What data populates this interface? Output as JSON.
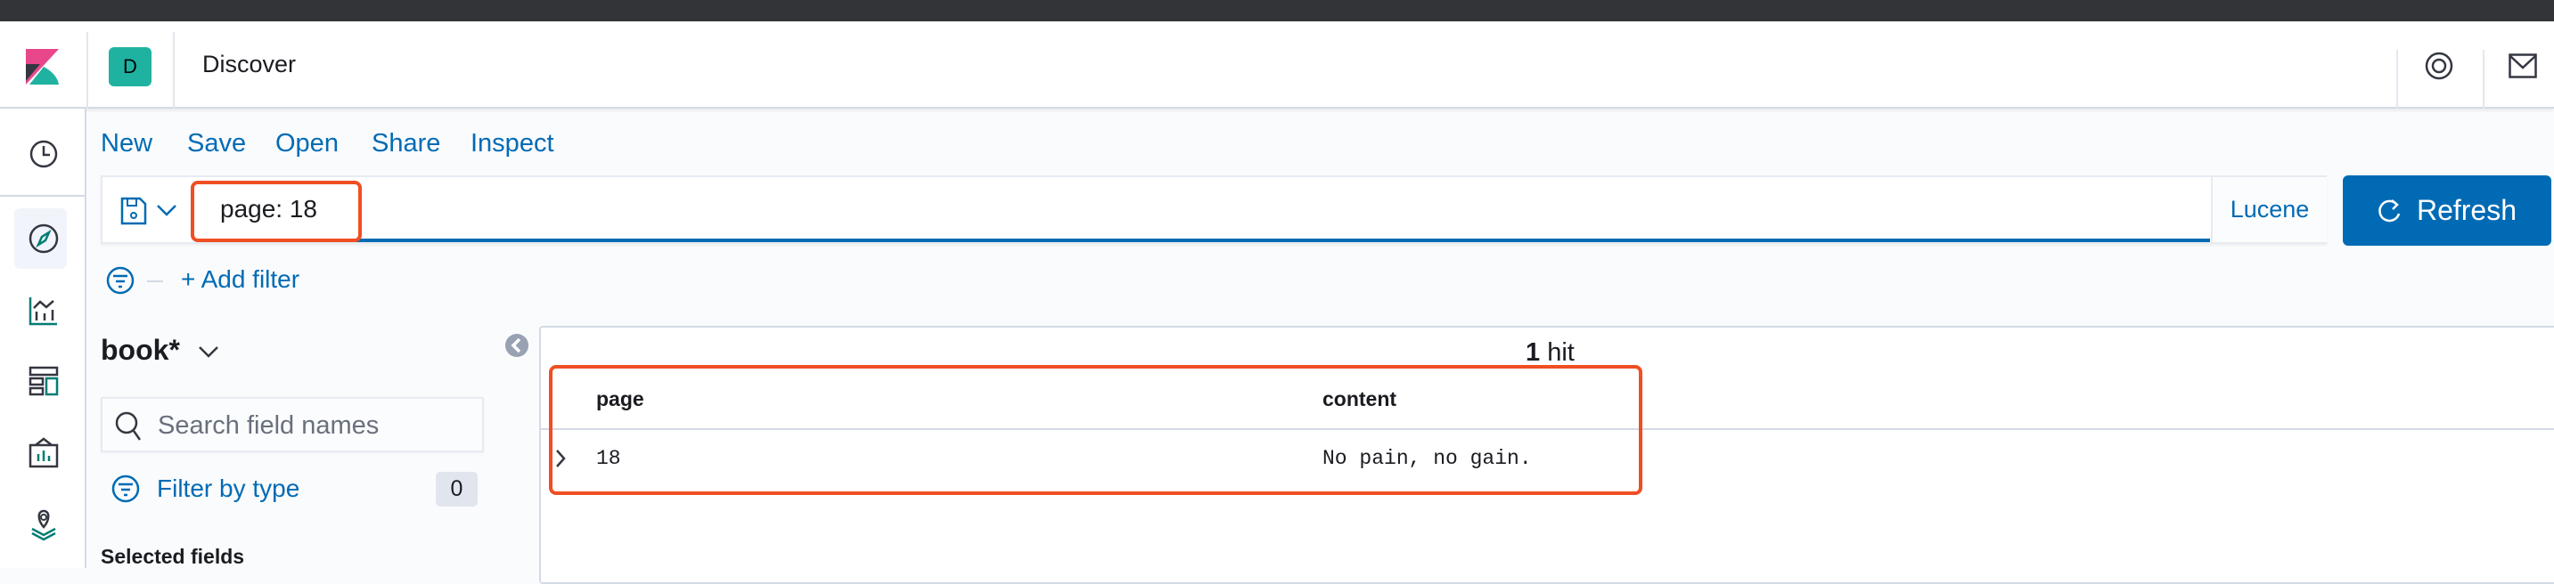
{
  "header": {
    "app_badge": "D",
    "title": "Discover"
  },
  "top_menu": [
    "New",
    "Save",
    "Open",
    "Share",
    "Inspect"
  ],
  "query": {
    "value": "page: 18",
    "language": "Lucene",
    "refresh_label": "Refresh"
  },
  "filter": {
    "add_label": "+ Add filter"
  },
  "sidebar": {
    "index_pattern": "book*",
    "search_placeholder": "Search field names",
    "filter_by_type": "Filter by type",
    "filter_count": "0",
    "selected_fields": "Selected fields"
  },
  "results": {
    "hit_count": "1",
    "hit_label": "hit",
    "columns": [
      "page",
      "content"
    ],
    "rows": [
      [
        "18",
        "No pain, no gain."
      ]
    ]
  },
  "colors": {
    "accent": "#006bb4",
    "highlight": "#f04e23",
    "badge": "#20b2a0"
  }
}
